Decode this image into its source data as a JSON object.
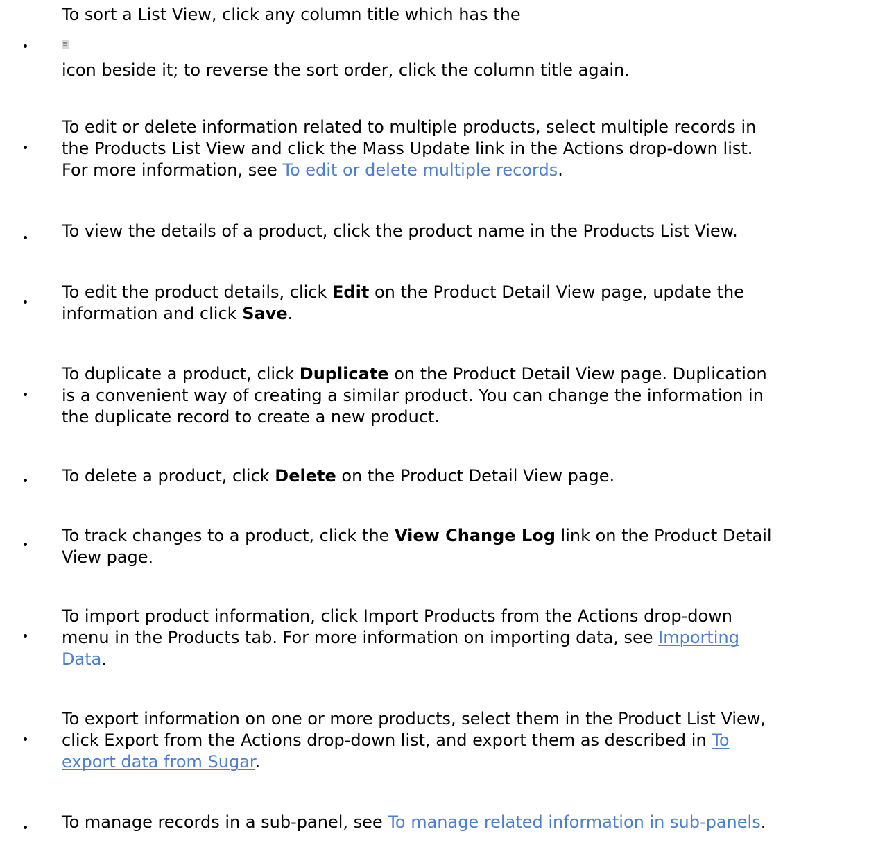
{
  "items": [
    {
      "before_icon": "To sort a List View, click any column title which has the",
      "icon": "sort-icon",
      "after_icon": "icon beside it; to reverse the sort order, click the column title again."
    },
    {
      "line1": "To edit or delete information related to multiple products, select multiple records in",
      "line2": "the Products List View and click the Mass Update link in the Actions drop-down list.",
      "line3_pre": "For more information, see ",
      "link": "To edit or delete multiple records",
      "line3_post": "."
    },
    {
      "line1": "To view the details of a product, click the product name in the Products List View."
    },
    {
      "line1_pre": "To edit the product details, click ",
      "bold1": "Edit",
      "line1_post": " on the Product Detail View page, update the",
      "line2_pre": "information and click ",
      "bold2": "Save",
      "line2_post": "."
    },
    {
      "line1_pre": "To duplicate a product, click ",
      "bold": "Duplicate",
      "line1_post": " on the Product Detail View page. Duplication",
      "line2": "is a convenient way of creating a similar product. You can change the information in",
      "line3": "the duplicate record to create a new product."
    },
    {
      "pre": "To delete a product, click ",
      "bold": "Delete",
      "post": " on the Product Detail View page."
    },
    {
      "line1_pre": "To track changes to a product, click the ",
      "bold": "View Change Log",
      "line1_post": " link on the Product Detail",
      "line2": "View page."
    },
    {
      "line1": "To import product information, click Import Products from the Actions drop-down",
      "line2_pre": "menu in the Products tab. For more information on importing data, see ",
      "link_part1": "Importing",
      "link_part2": "Data",
      "line3_post": "."
    },
    {
      "line1": "To export information on one or more products, select them in the Product List View,",
      "line2_pre": "click Export from the Actions drop-down list, and export them as described in ",
      "link_part1": "To",
      "link_part2": "export data from Sugar",
      "line3_post": "."
    },
    {
      "pre": "To manage records in a sub-panel, see ",
      "link": "To manage related information in sub-panels",
      "post": "."
    }
  ],
  "colors": {
    "link": "#4a7fd4",
    "text": "#000000"
  }
}
